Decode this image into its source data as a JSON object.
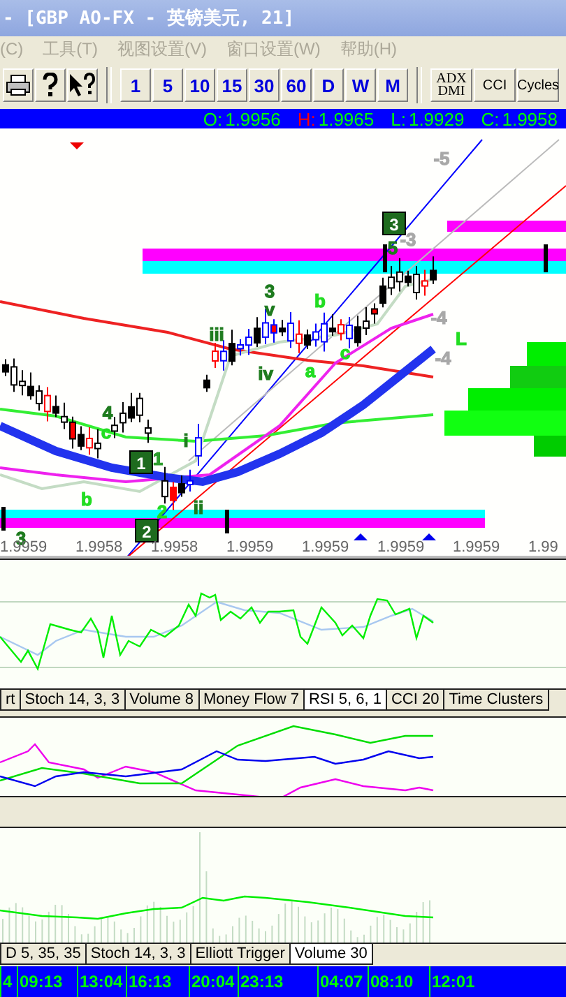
{
  "window": {
    "title": "- [GBP AO-FX - 英镑美元, 21]"
  },
  "menu": [
    {
      "label": "(C)"
    },
    {
      "label": "工具(T)"
    },
    {
      "label": "视图设置(V)"
    },
    {
      "label": "窗口设置(W)"
    },
    {
      "label": "帮助(H)"
    }
  ],
  "toolbar": {
    "periods": [
      "1",
      "5",
      "10",
      "15",
      "30",
      "60",
      "D",
      "W",
      "M"
    ],
    "indicators": [
      {
        "lines": [
          "ADX",
          "DMI"
        ]
      },
      {
        "lines": [
          "CCI"
        ]
      },
      {
        "lines": [
          "Cycles"
        ]
      }
    ]
  },
  "quote": [
    {
      "label": "O:",
      "value": "1.9956",
      "kind": "open"
    },
    {
      "label": "H:",
      "value": "1.9965",
      "kind": "high"
    },
    {
      "label": "L:",
      "value": "1.9929",
      "kind": "low"
    },
    {
      "label": "C:",
      "value": "1.9958",
      "kind": "close"
    }
  ],
  "price_chart": {
    "wave_labels": [
      {
        "text": "3",
        "kind": "label",
        "color": "#1e7b1e"
      },
      {
        "text": "4",
        "kind": "label",
        "color": "#1e7b1e"
      },
      {
        "text": "c",
        "kind": "label",
        "color": "#22dd22"
      },
      {
        "text": "b",
        "kind": "label",
        "color": "#22dd22"
      },
      {
        "text": "1",
        "kind": "badge",
        "color": "#1e6b1e"
      },
      {
        "text": "1",
        "kind": "label",
        "color": "#2e9e2e"
      },
      {
        "text": "2",
        "kind": "badge",
        "color": "#1e6b1e"
      },
      {
        "text": "2",
        "kind": "label",
        "color": "#22dd22"
      },
      {
        "text": "ii",
        "kind": "label",
        "color": "#1e7b1e"
      },
      {
        "text": "i",
        "kind": "label",
        "color": "#1e7b1e"
      },
      {
        "text": "iii",
        "kind": "label",
        "color": "#1e7b1e"
      },
      {
        "text": "3",
        "kind": "label",
        "color": "#1e7b1e"
      },
      {
        "text": "v",
        "kind": "label",
        "color": "#1e7b1e"
      },
      {
        "text": "iv",
        "kind": "label",
        "color": "#1e7b1e"
      },
      {
        "text": "b",
        "kind": "label",
        "color": "#22dd22"
      },
      {
        "text": "a",
        "kind": "label",
        "color": "#22dd22"
      },
      {
        "text": "c",
        "kind": "label",
        "color": "#22dd22"
      },
      {
        "text": "3",
        "kind": "badge",
        "color": "#1e6b1e"
      },
      {
        "text": "5",
        "kind": "label",
        "color": "#1e7b1e"
      },
      {
        "text": "-3",
        "kind": "label",
        "color": "#a8a8a8"
      },
      {
        "text": "-5",
        "kind": "label",
        "color": "#a8a8a8"
      },
      {
        "text": "-4",
        "kind": "label",
        "color": "#a8a8a8"
      },
      {
        "text": "-4",
        "kind": "label",
        "color": "#a8a8a8"
      },
      {
        "text": "L",
        "kind": "label",
        "color": "#22dd22"
      }
    ],
    "price_axis": [
      "1.9959",
      "1.9958",
      "1.9958",
      "1.9959",
      "1.9959",
      "1.9959",
      "1.9959",
      "1.99"
    ]
  },
  "indicator_tabs": [
    {
      "label": "rt",
      "selected": false
    },
    {
      "label": "Stoch 14, 3, 3",
      "selected": false
    },
    {
      "label": "Volume 8",
      "selected": false
    },
    {
      "label": "Money Flow 7",
      "selected": false
    },
    {
      "label": "RSI 5, 6, 1",
      "selected": true
    },
    {
      "label": "CCI 20",
      "selected": false
    },
    {
      "label": "Time Clusters",
      "selected": false
    }
  ],
  "lower_tabs": [
    {
      "label": "D 5, 35, 35",
      "selected": false
    },
    {
      "label": "Stoch 14, 3, 3",
      "selected": false
    },
    {
      "label": "Elliott Trigger",
      "selected": false
    },
    {
      "label": "Volume 30",
      "selected": true
    }
  ],
  "time_axis": [
    "4",
    "09:13",
    "13:04",
    "16:13",
    "20:04",
    "23:13",
    "04:07",
    "08:10",
    "12:01"
  ]
}
